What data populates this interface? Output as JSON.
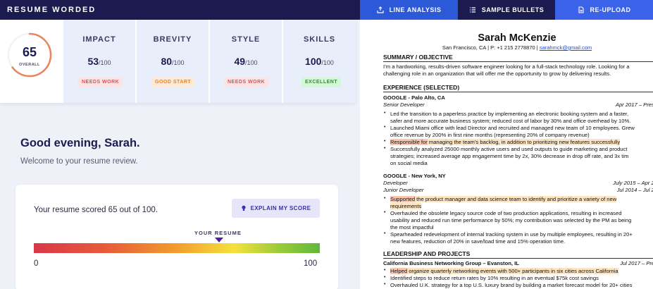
{
  "brand": "RESUME WORDED",
  "tabs": [
    {
      "label": "LINE ANALYSIS"
    },
    {
      "label": "SAMPLE BULLETS"
    },
    {
      "label": "RE-UPLOAD"
    }
  ],
  "overall": {
    "score": "65",
    "label": "OVERALL",
    "fraction": 0.65
  },
  "metrics": [
    {
      "title": "IMPACT",
      "score": "53",
      "denom": "/100",
      "badge": "NEEDS WORK"
    },
    {
      "title": "BREVITY",
      "score": "80",
      "denom": "/100",
      "badge": "GOOD START"
    },
    {
      "title": "STYLE",
      "score": "49",
      "denom": "/100",
      "badge": "NEEDS WORK"
    },
    {
      "title": "SKILLS",
      "score": "100",
      "denom": "/100",
      "badge": "EXCELLENT"
    }
  ],
  "greeting": "Good evening, Sarah.",
  "welcome": "Welcome to your resume review.",
  "card": {
    "scored_text": "Your resume scored 65 out of 100.",
    "explain_label": "EXPLAIN MY SCORE",
    "marker_label": "YOUR RESUME",
    "min": "0",
    "max": "100"
  },
  "colors": {
    "navy": "#1c1b4f",
    "blue_tab": "#2c59d8",
    "ring": "#e8855a"
  },
  "resume": {
    "name": "Sarah McKenzie",
    "contact_prefix": "San Francisco, CA | P: +1 215 2778870 | ",
    "email": "sarahmck@gmail.com",
    "summary_heading": "SUMMARY / OBJECTIVE",
    "summary_1": "I’m a hardworking, results-driven software engineer looking for a full-stack technology role. Looking for a",
    "summary_2": "challenging role in an organization that will offer me the opportunity to grow by delivering results.",
    "exp_heading": "EXPERIENCE (SELECTED)",
    "job1_company": "GOOGLE - Palo Alto, CA",
    "job1_title": "Senior Developer",
    "job1_dates": "Apr 2017 – Prese",
    "job1_b1_1": "Led the transition to a paperless practice by implementing an electronic booking system and a faster,",
    "job1_b1_2": "safer and more accurate business system; reduced cost of labor by 30% and office overhead by 10%.",
    "job1_b2_1": "Launched Miami office with lead Director and recruited and managed new team of 10 employees. Grew",
    "job1_b2_2": "office revenue by 200% in first nine months (representing 20% of company revenue)",
    "job1_b3_hl": "Responsible for",
    "job1_b3_rest": " managing the team’s backlog, in addition to prioritizing new features successfully",
    "job1_b4_1": "Successfully analyzed 25000 monthly active users and used outputs to guide marketing and product",
    "job1_b4_2": "strategies; increased average app engagement time by 2x, 30% decrease in drop off rate, and 3x tim",
    "job1_b4_3": "on social media",
    "job2_company": "GOOGLE - New York, NY",
    "job2_title1": "Developer",
    "job2_dates1": "July 2015 – Apr 20",
    "job2_title2": "Junior Developer",
    "job2_dates2": "Jul 2014 – Jul 20",
    "job2_b1_hl": "Supported",
    "job2_b1_rest": " the product manager and data science team to identify and prioritize a variety of new",
    "job2_b1_2": "requirements",
    "job2_b2_1": "Overhauled the obsolete legacy source code of two production applications, resulting in increased",
    "job2_b2_2": "usability and reduced run time performance by 50%; my contribution was selected by the PM as being",
    "job2_b2_3": "the most impactful",
    "job2_b3_1": "Spearheaded redevelopment of internal tracking system in use by multiple employees, resulting in 20+",
    "job2_b3_2": "new features, reduction of 20% in save/load time and 15% operation time.",
    "lead_heading": "LEADERSHIP AND PROJECTS",
    "lead_company": "California Business Networking Group – Evanston, IL",
    "lead_dates": "Jul 2017 – Pres",
    "lead_b1_hl": "Helped",
    "lead_b1_rest": " organize quarterly networking events with 500+ participants in six cities across California",
    "lead_b2": "Identified steps to reduce return rates by 10% resulting in an eventual $75k cost savings",
    "lead_b3": "Overhauled U.K. strategy for a top U.S. luxury brand by building a market forecast model for 20+ cities"
  }
}
